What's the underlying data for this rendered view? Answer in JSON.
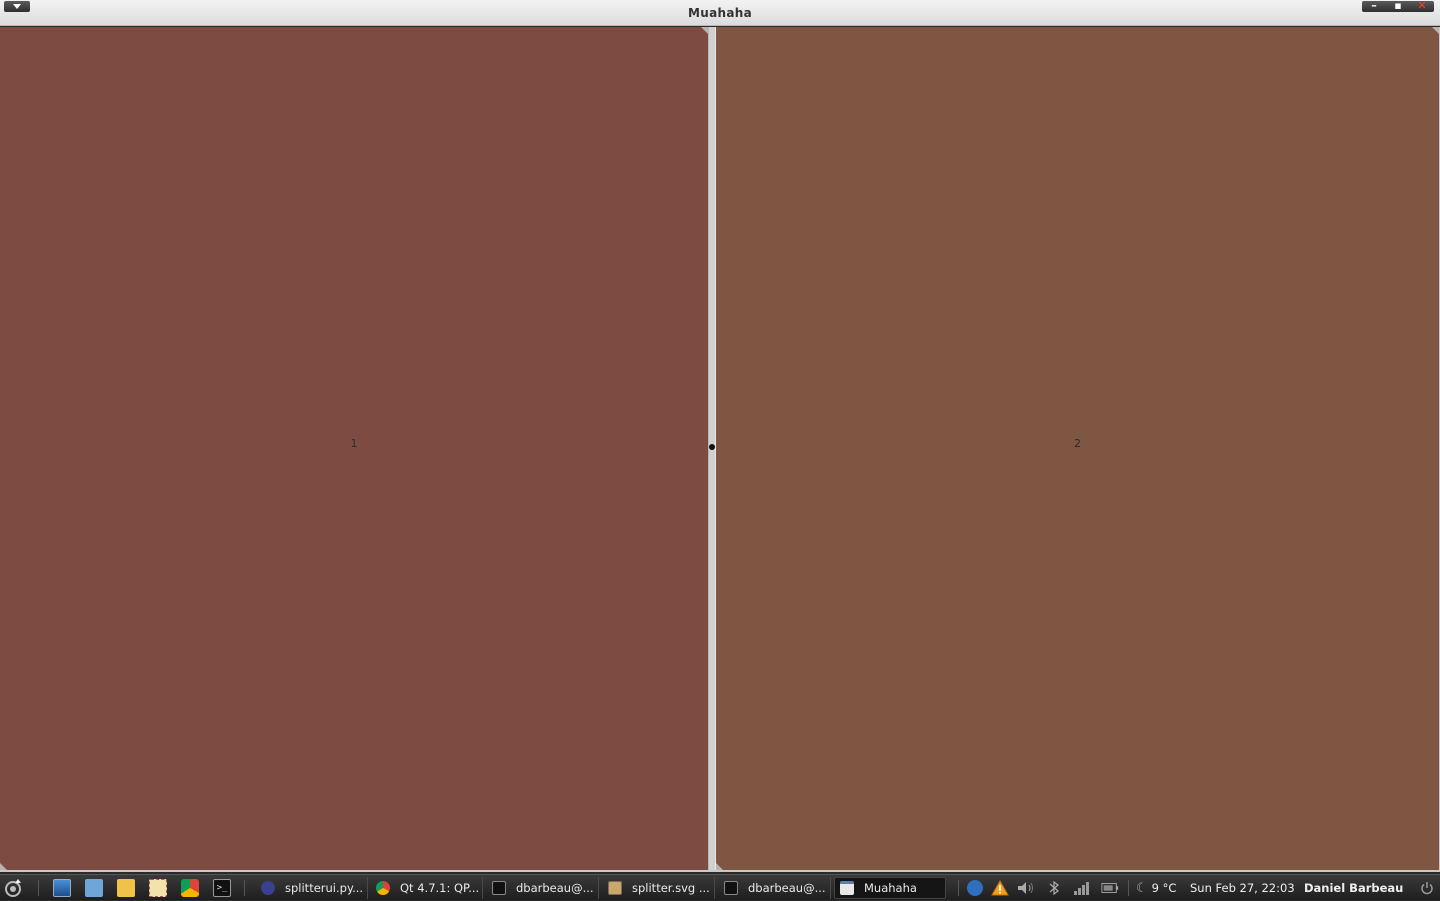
{
  "window": {
    "title": "Muahaha",
    "controls": {
      "minimize": "–",
      "maximize": "▪",
      "close": "✕"
    }
  },
  "panes": [
    {
      "label": "1",
      "color": "#7d4b42"
    },
    {
      "label": "2",
      "color": "#7f5642"
    }
  ],
  "taskbar": {
    "launchers": [
      {
        "name": "desktop-icon"
      },
      {
        "name": "home-folder-icon"
      },
      {
        "name": "file-manager-icon"
      },
      {
        "name": "mail-icon"
      },
      {
        "name": "chrome-icon"
      },
      {
        "name": "terminal-icon"
      }
    ],
    "tasks": [
      {
        "label": "splitterui.py...",
        "icon": "eclipse-icon"
      },
      {
        "label": "Qt 4.7.1: QP...",
        "icon": "chrome-icon"
      },
      {
        "label": "dbarbeau@...",
        "icon": "terminal-icon"
      },
      {
        "label": "splitter.svg ...",
        "icon": "inkscape-icon"
      },
      {
        "label": "dbarbeau@...",
        "icon": "terminal-icon"
      },
      {
        "label": "Muahaha",
        "icon": "window-icon",
        "active": true
      }
    ],
    "tray": {
      "weather": "9 °C",
      "datetime": "Sun Feb 27, 22:03",
      "user": "Daniel Barbeau"
    }
  }
}
